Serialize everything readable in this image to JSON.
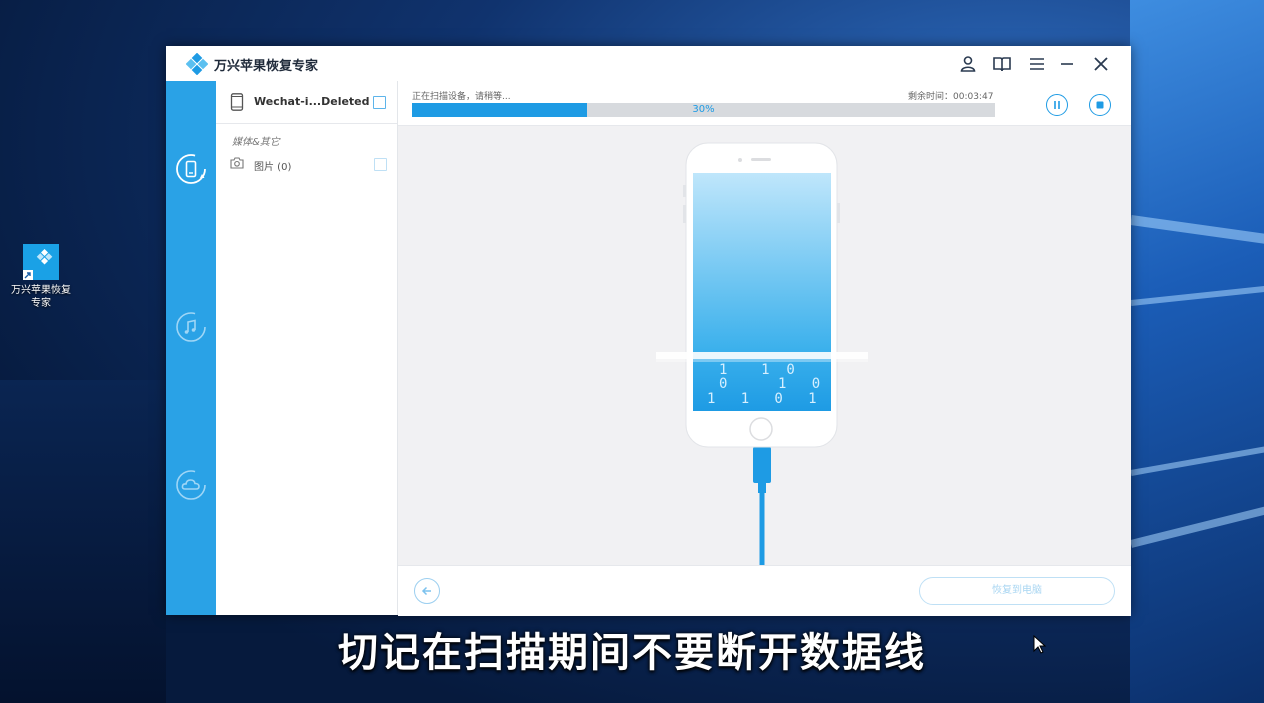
{
  "desktop": {
    "icon_label": "万兴苹果恢复\n专家"
  },
  "window": {
    "title": "万兴苹果恢复专家"
  },
  "sidebar": {
    "device_name": "Wechat-i...Deleted",
    "category_title": "媒体&其它",
    "items": [
      {
        "label": "图片 (0)",
        "icon": "camera-icon"
      }
    ]
  },
  "scan": {
    "status": "正在扫描设备，请稍等...",
    "remaining": "剩余时间：00:03:47",
    "progress_label": "30%",
    "progress_value": 0.3
  },
  "bottom": {
    "recover_label": "恢复到电脑"
  },
  "phone_binary": [
    "1    1  0",
    "0      1   0",
    "1   1   0   1"
  ],
  "subtitle": "切记在扫描期间不要断开数据线",
  "colors": {
    "accent": "#1e9be4",
    "rail": "#2aa2e6"
  }
}
